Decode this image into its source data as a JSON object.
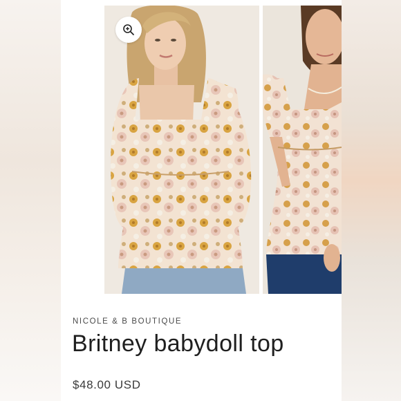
{
  "product": {
    "vendor": "NICOLE & B BOUTIQUE",
    "title": "Britney babydoll top",
    "price": "$48.00 USD"
  },
  "gallery": {
    "zoom_icon": "zoom-in-icon",
    "images": [
      {
        "name": "model-front-photo"
      },
      {
        "name": "model-alt-photo"
      }
    ]
  },
  "colors": {
    "text_primary": "#1f1f1f",
    "text_secondary": "#4a4a4a",
    "floral_gold": "#d9a441",
    "floral_pink": "#e8c6b8",
    "denim": "#1f3d6b"
  }
}
